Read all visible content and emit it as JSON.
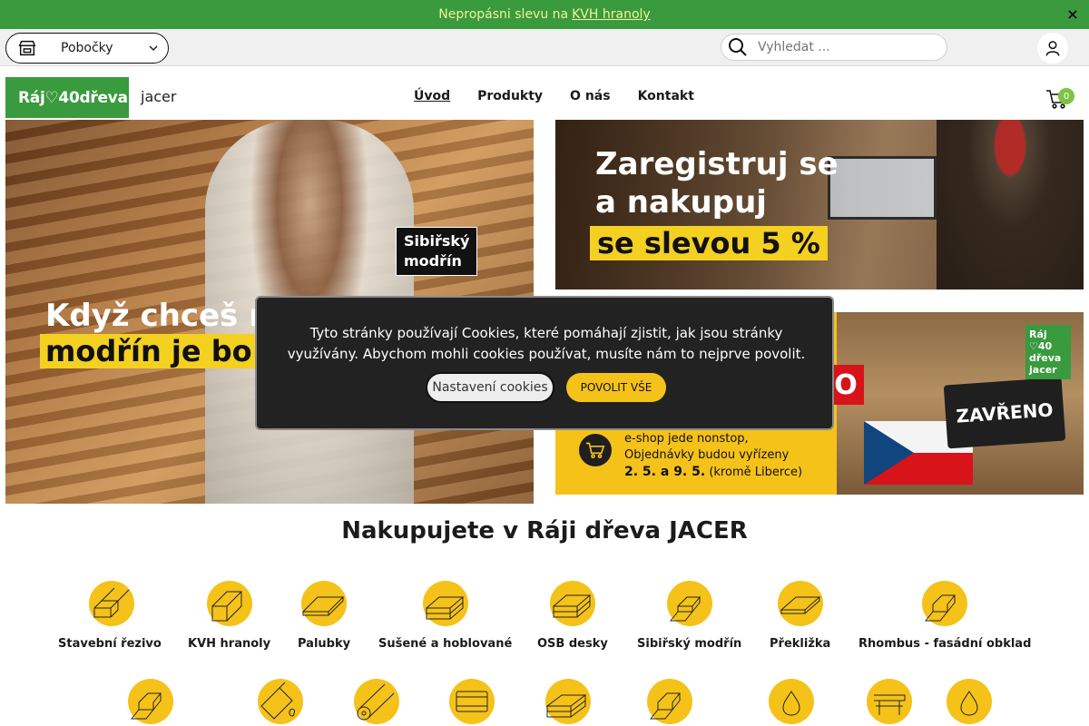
{
  "promo": {
    "text": "Nepropásni slevu na",
    "link": "KVH hranoly",
    "close": "×"
  },
  "util": {
    "branches_label": "Pobočky",
    "search_placeholder": "Vyhledat ..."
  },
  "header": {
    "logo_text": "Ráj♡40dřeva",
    "logo_jacer": "jacer",
    "nav": [
      "Úvod",
      "Produkty",
      "O nás",
      "Kontakt"
    ],
    "cart_count": "0"
  },
  "hero": {
    "tag_line1": "Sibiřský",
    "tag_line2": "modřín",
    "headline1": "Když chceš n",
    "headline2": "modřín je bo"
  },
  "banner1": {
    "line1": "Zaregistruj se",
    "line2": "a nakupuj",
    "line3": "se slevou 5 %"
  },
  "banner2": {
    "red_letter": "O",
    "sign": "ZAVŘENO",
    "badge_line1": "Ráj",
    "badge_line2": "♡40",
    "badge_line3": "dřeva",
    "badge_line4": "jacer",
    "info_line1": "e-shop jede nonstop,",
    "info_line2": "Objednávky budou vyřízeny",
    "info_line3_bold": "2. 5. a 9. 5.",
    "info_line3_rest": "(kromě Liberce)"
  },
  "section_title": "Nakupujete v Ráji dřeva JACER",
  "categories_row1": [
    "Stavební řezivo",
    "KVH hranoly",
    "Palubky",
    "Sušené a hoblované",
    "OSB desky",
    "Sibiřský modřín",
    "Překližka",
    "Rhombus - fasádní obklad"
  ],
  "cookie": {
    "text": "Tyto stránky používají Cookies, které pomáhají zjistit, jak jsou stránky využívány. Abychom mohli cookies používat, musíte nám to nejprve povolit.",
    "settings_label": "Nastavení cookies",
    "allow_label": "POVOLIT VŠE"
  },
  "colors": {
    "brand_green": "#3a9a3e",
    "accent_yellow": "#f5c21a",
    "promo_text": "#f4f19a"
  },
  "icons": [
    "store-icon",
    "chevron-down-icon",
    "search-icon",
    "user-icon",
    "cart-icon",
    "close-icon"
  ]
}
